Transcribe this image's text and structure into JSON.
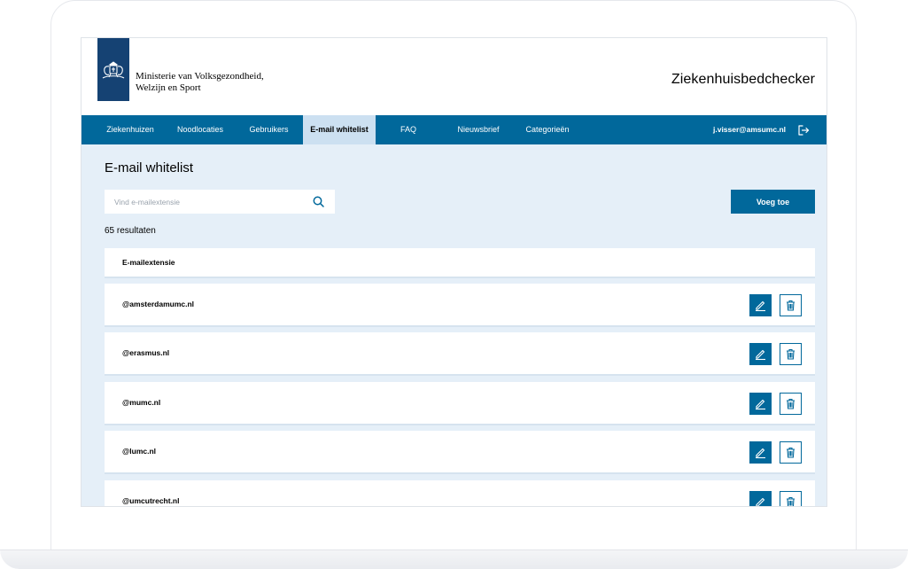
{
  "header": {
    "ministry_line1": "Ministerie van Volksgezondheid,",
    "ministry_line2": "Welzijn en Sport",
    "app_title": "Ziekenhuisbedchecker"
  },
  "nav": {
    "items": [
      {
        "label": "Ziekenhuizen"
      },
      {
        "label": "Noodlocaties"
      },
      {
        "label": "Gebruikers"
      },
      {
        "label": "E-mail whitelist",
        "active": true
      },
      {
        "label": "FAQ"
      },
      {
        "label": "Nieuwsbrief"
      },
      {
        "label": "Categorieën"
      }
    ],
    "user_email": "j.visser@amsumc.nl"
  },
  "main": {
    "title": "E-mail whitelist",
    "search_placeholder": "Vind e-mailextensie",
    "add_button_label": "Voeg toe",
    "result_count": "65 resultaten",
    "table_header": "E-mailextensie",
    "rows": [
      {
        "extension": "@amsterdamumc.nl"
      },
      {
        "extension": "@erasmus.nl"
      },
      {
        "extension": "@mumc.nl"
      },
      {
        "extension": "@lumc.nl"
      },
      {
        "extension": "@umcutrecht.nl"
      }
    ]
  },
  "icons": {
    "logo": "coat-of-arms-icon",
    "logout": "logout-icon",
    "search": "search-icon",
    "edit": "pencil-icon",
    "delete": "trash-icon"
  },
  "colors": {
    "primary": "#01689b",
    "logo_bar": "#154273",
    "active_tab": "#cce0f1",
    "background": "#e5eff8"
  }
}
